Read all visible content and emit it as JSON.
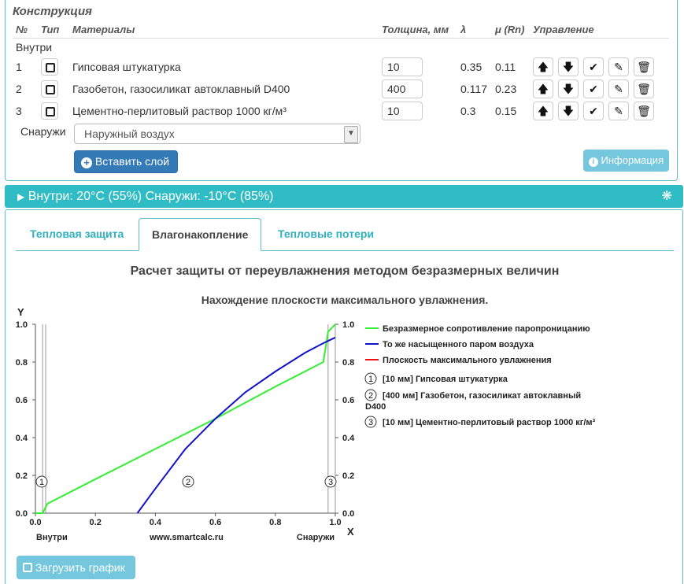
{
  "construction": {
    "title": "Конструкция",
    "headers": [
      "№",
      "Тип",
      "Материалы",
      "Толщина, мм",
      "λ",
      "μ (Rn)",
      "Управление"
    ],
    "inside_label": "Внутри",
    "outside_label": "Снаружи",
    "layers": [
      {
        "num": "1",
        "material": "Гипсовая штукатурка",
        "thickness": "10",
        "lambda": "0.35",
        "mu": "0.11"
      },
      {
        "num": "2",
        "material": "Газобетон, газосиликат автоклавный D400",
        "thickness": "400",
        "lambda": "0.117",
        "mu": "0.23"
      },
      {
        "num": "3",
        "material": "Цементно-перлитовый раствор 1000 кг/м³",
        "thickness": "10",
        "lambda": "0.3",
        "mu": "0.15"
      }
    ],
    "outside_select": "Наружный воздух",
    "insert_button": "Вставить слой",
    "info_button": "Информация"
  },
  "conditions_bar": "Внутри: 20°C (55%) Снаружи: -10°C (85%)",
  "tabs": [
    "Тепловая защита",
    "Влагонакопление",
    "Тепловые потери"
  ],
  "active_tab": 1,
  "main_title": "Расчет защиты от переувлажнения методом безразмерных величин",
  "sub_title": "Нахождение плоскости максимального увлажнения.",
  "load_button": "Загрузить график",
  "colors": {
    "accent": "#2fbcc4",
    "primary": "#337ab7",
    "info": "#74c7dd"
  },
  "chart_data": {
    "type": "line",
    "xlabel": "X",
    "ylabel": "Y",
    "xlim": [
      0,
      1
    ],
    "ylim": [
      0,
      1
    ],
    "x_ticks": [
      "0.0",
      "0.2",
      "0.4",
      "0.6",
      "0.8",
      "1.0"
    ],
    "y_ticks": [
      "0.0",
      "0.2",
      "0.4",
      "0.6",
      "0.8",
      "1.0"
    ],
    "left_label": "Внутри",
    "center_label": "www.smartcalc.ru",
    "right_label": "Снаружи",
    "layer_bounds": [
      0.0,
      0.024,
      0.976,
      1.0
    ],
    "layer_markers": [
      "1",
      "2",
      "3"
    ],
    "series": [
      {
        "name": "Безразмерное сопротивление паропроницанию",
        "color": "#33ee33",
        "x": [
          0,
          0.024,
          0.04,
          0.2,
          0.4,
          0.6,
          0.8,
          0.96,
          0.976,
          1.0
        ],
        "y": [
          0,
          0.0,
          0.05,
          0.18,
          0.34,
          0.5,
          0.67,
          0.8,
          0.96,
          1.0
        ]
      },
      {
        "name": "То же насыщенного паром воздуха",
        "color": "#1111cc",
        "x": [
          0.34,
          0.4,
          0.5,
          0.6,
          0.7,
          0.8,
          0.9,
          0.96,
          1.0
        ],
        "y": [
          0.0,
          0.13,
          0.34,
          0.5,
          0.64,
          0.75,
          0.85,
          0.9,
          0.93
        ]
      },
      {
        "name": "Плоскость максимального увлажнения",
        "color": "#ee1111",
        "x": [],
        "y": []
      }
    ],
    "legend_layers": [
      "[10 мм] Гипсовая штукатурка",
      "[400 мм] Газобетон, газосиликат автоклавный D400",
      "[10 мм] Цементно-перлитовый раствор 1000 кг/м³"
    ]
  }
}
